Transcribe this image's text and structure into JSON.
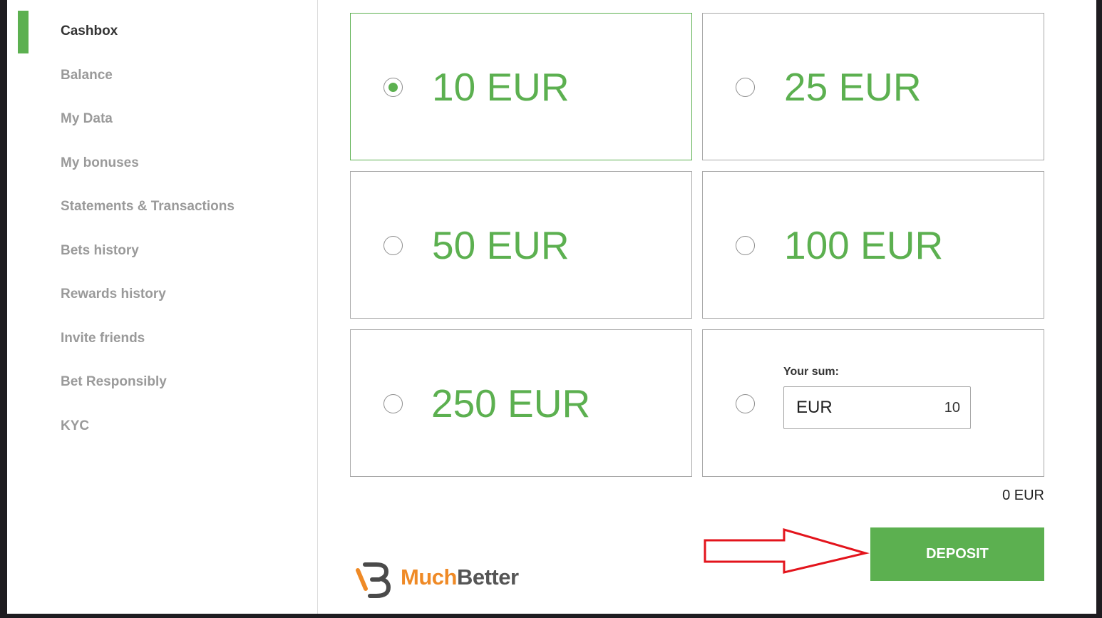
{
  "sidebar": {
    "items": [
      {
        "label": "Cashbox",
        "active": true
      },
      {
        "label": "Balance"
      },
      {
        "label": "My Data"
      },
      {
        "label": "My bonuses"
      },
      {
        "label": "Statements & Transactions"
      },
      {
        "label": "Bets history"
      },
      {
        "label": "Rewards history"
      },
      {
        "label": "Invite friends"
      },
      {
        "label": "Bet Responsibly"
      },
      {
        "label": "KYC"
      }
    ]
  },
  "amounts": {
    "options": [
      {
        "label": "10 EUR",
        "selected": true
      },
      {
        "label": "25 EUR"
      },
      {
        "label": "50 EUR"
      },
      {
        "label": "100 EUR"
      },
      {
        "label": "250 EUR"
      }
    ],
    "custom": {
      "label": "Your sum:",
      "currency": "EUR",
      "value": "10"
    }
  },
  "total": "0 EUR",
  "deposit_label": "DEPOSIT",
  "brand": {
    "name_part1": "Much",
    "name_part2": "Better"
  },
  "colors": {
    "accent": "#5cb050",
    "brand_orange": "#ef8a26",
    "arrow": "#e3141c"
  }
}
